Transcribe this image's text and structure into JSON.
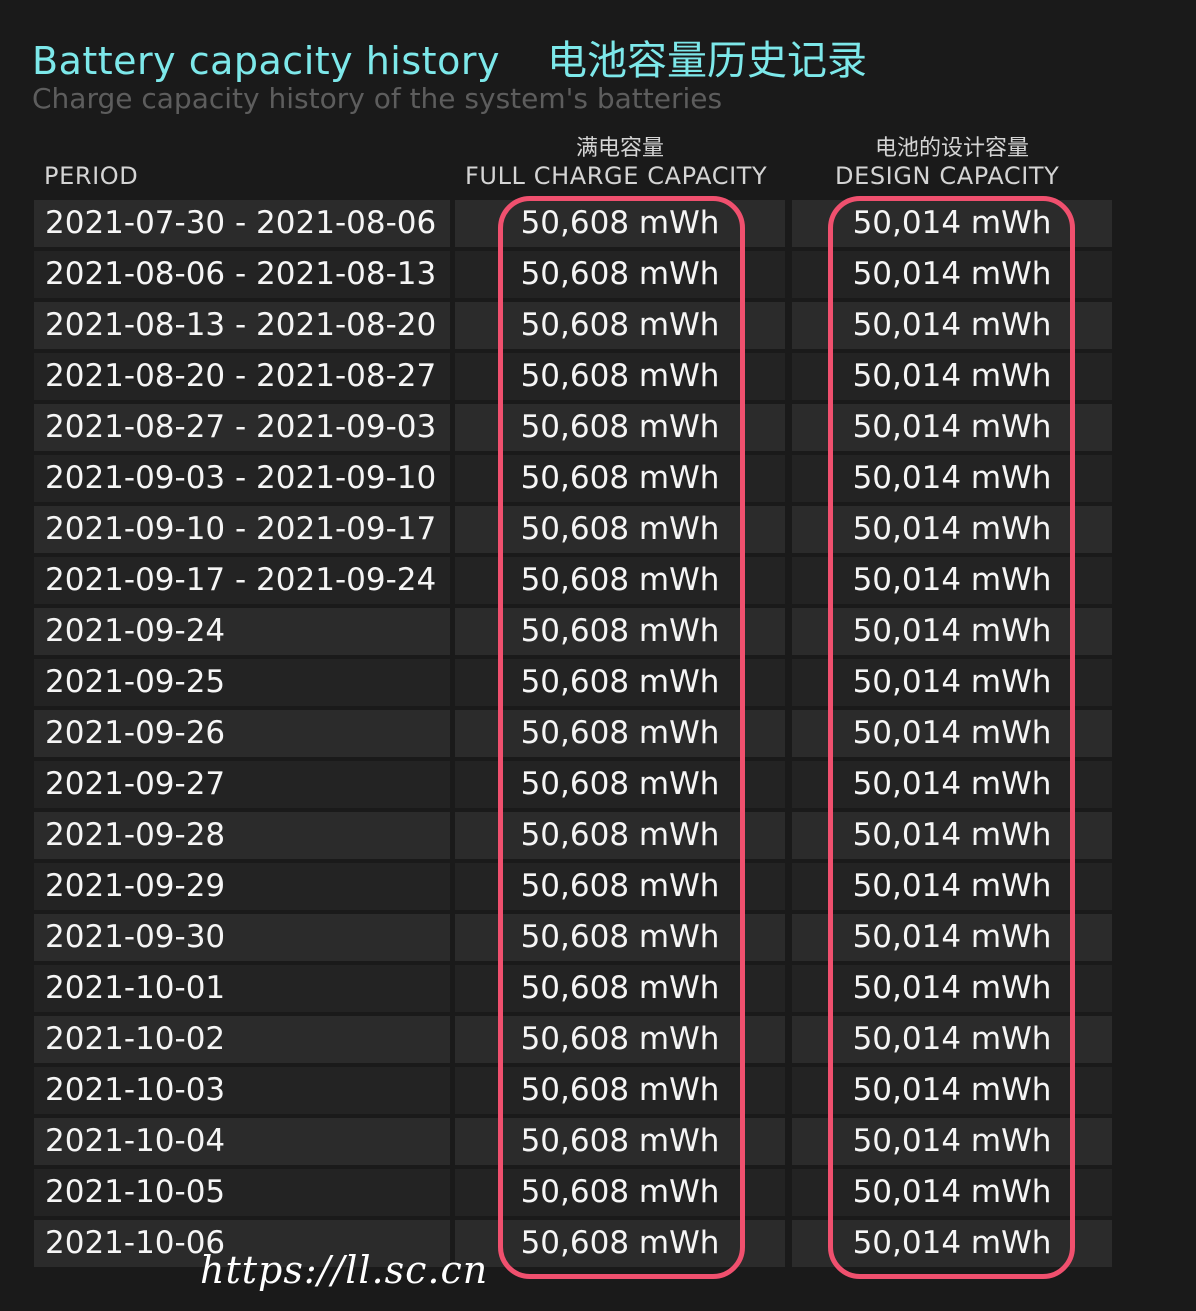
{
  "header": {
    "title_en": "Battery capacity history",
    "title_cn": "电池容量历史记录",
    "subtitle": "Charge capacity history of the system's batteries"
  },
  "table": {
    "columns": {
      "period": "PERIOD",
      "full_cn": "满电容量",
      "full": "FULL CHARGE CAPACITY",
      "design_cn": "电池的设计容量",
      "design": "DESIGN CAPACITY"
    },
    "rows": [
      {
        "period": "2021-07-30 - 2021-08-06",
        "full": "50,608 mWh",
        "design": "50,014 mWh"
      },
      {
        "period": "2021-08-06 - 2021-08-13",
        "full": "50,608 mWh",
        "design": "50,014 mWh"
      },
      {
        "period": "2021-08-13 - 2021-08-20",
        "full": "50,608 mWh",
        "design": "50,014 mWh"
      },
      {
        "period": "2021-08-20 - 2021-08-27",
        "full": "50,608 mWh",
        "design": "50,014 mWh"
      },
      {
        "period": "2021-08-27 - 2021-09-03",
        "full": "50,608 mWh",
        "design": "50,014 mWh"
      },
      {
        "period": "2021-09-03 - 2021-09-10",
        "full": "50,608 mWh",
        "design": "50,014 mWh"
      },
      {
        "period": "2021-09-10 - 2021-09-17",
        "full": "50,608 mWh",
        "design": "50,014 mWh"
      },
      {
        "period": "2021-09-17 - 2021-09-24",
        "full": "50,608 mWh",
        "design": "50,014 mWh"
      },
      {
        "period": "2021-09-24",
        "full": "50,608 mWh",
        "design": "50,014 mWh"
      },
      {
        "period": "2021-09-25",
        "full": "50,608 mWh",
        "design": "50,014 mWh"
      },
      {
        "period": "2021-09-26",
        "full": "50,608 mWh",
        "design": "50,014 mWh"
      },
      {
        "period": "2021-09-27",
        "full": "50,608 mWh",
        "design": "50,014 mWh"
      },
      {
        "period": "2021-09-28",
        "full": "50,608 mWh",
        "design": "50,014 mWh"
      },
      {
        "period": "2021-09-29",
        "full": "50,608 mWh",
        "design": "50,014 mWh"
      },
      {
        "period": "2021-09-30",
        "full": "50,608 mWh",
        "design": "50,014 mWh"
      },
      {
        "period": "2021-10-01",
        "full": "50,608 mWh",
        "design": "50,014 mWh"
      },
      {
        "period": "2021-10-02",
        "full": "50,608 mWh",
        "design": "50,014 mWh"
      },
      {
        "period": "2021-10-03",
        "full": "50,608 mWh",
        "design": "50,014 mWh"
      },
      {
        "period": "2021-10-04",
        "full": "50,608 mWh",
        "design": "50,014 mWh"
      },
      {
        "period": "2021-10-05",
        "full": "50,608 mWh",
        "design": "50,014 mWh"
      },
      {
        "period": "2021-10-06",
        "full": "50,608 mWh",
        "design": "50,014 mWh"
      }
    ]
  },
  "watermark": "https://ll.sc.cn",
  "colors": {
    "background": "#1a1a1a",
    "title": "#7de8ea",
    "highlight": "#f0506e"
  }
}
